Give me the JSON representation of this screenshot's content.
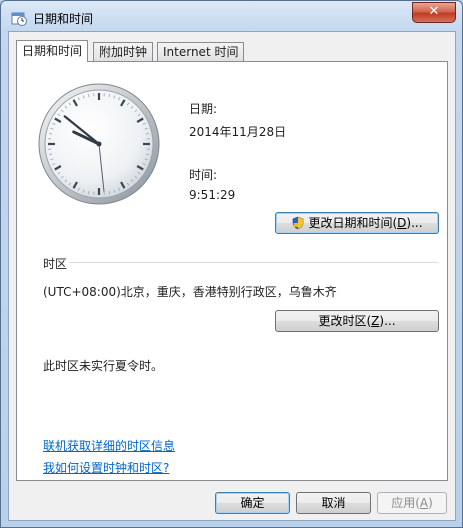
{
  "window": {
    "title": "日期和时间",
    "close_label": "✕"
  },
  "tabs": [
    {
      "label": "日期和时间",
      "active": true
    },
    {
      "label": "附加时钟",
      "active": false
    },
    {
      "label": "Internet 时间",
      "active": false
    }
  ],
  "datetime": {
    "date_label": "日期:",
    "date_value": "2014年11月28日",
    "time_label": "时间:",
    "time_value": "9:51:29",
    "change_button": {
      "text": "更改日期和时间(",
      "key": "D",
      "suffix": ")..."
    }
  },
  "timezone": {
    "section_label": "时区",
    "value": "(UTC+08:00)北京，重庆，香港特别行政区，乌鲁木齐",
    "change_button": {
      "text": "更改时区(",
      "key": "Z",
      "suffix": ")..."
    },
    "dst_note": "此时区未实行夏令时。"
  },
  "links": {
    "online_info": "联机获取详细的时区信息",
    "how_to": "我如何设置时钟和时区?"
  },
  "footer": {
    "ok": "确定",
    "cancel": "取消",
    "apply_text": "应用(",
    "apply_key": "A",
    "apply_suffix": ")"
  },
  "icons": {
    "app": "calendar-clock-icon",
    "shield": "uac-shield-icon",
    "close": "close-icon"
  },
  "clock_state": {
    "hour": 9,
    "minute": 51,
    "second": 29
  }
}
